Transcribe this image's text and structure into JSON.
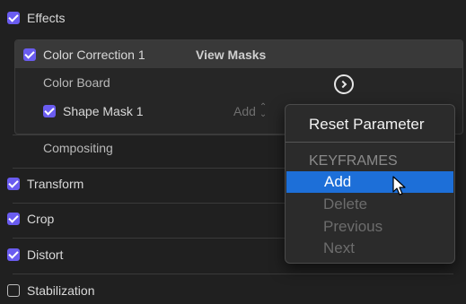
{
  "effects": {
    "label": "Effects",
    "checked": true
  },
  "color_correction": {
    "label": "Color Correction 1",
    "checked": true,
    "view_masks": "View Masks"
  },
  "color_board": {
    "label": "Color Board"
  },
  "shape_mask": {
    "label": "Shape Mask 1",
    "checked": true,
    "select_value": "Add"
  },
  "compositing": {
    "label": "Compositing"
  },
  "transform": {
    "label": "Transform",
    "checked": true
  },
  "crop": {
    "label": "Crop",
    "checked": true
  },
  "distort": {
    "label": "Distort",
    "checked": true
  },
  "stabilization": {
    "label": "Stabilization",
    "checked": false
  },
  "context_menu": {
    "reset": "Reset Parameter",
    "header": "KEYFRAMES",
    "items": [
      {
        "label": "Add",
        "highlighted": true,
        "enabled": true
      },
      {
        "label": "Delete",
        "enabled": false
      },
      {
        "label": "Previous",
        "enabled": false
      },
      {
        "label": "Next",
        "enabled": false
      }
    ]
  },
  "colors": {
    "accent": "#6a5cf0",
    "highlight": "#1d6fd8"
  }
}
